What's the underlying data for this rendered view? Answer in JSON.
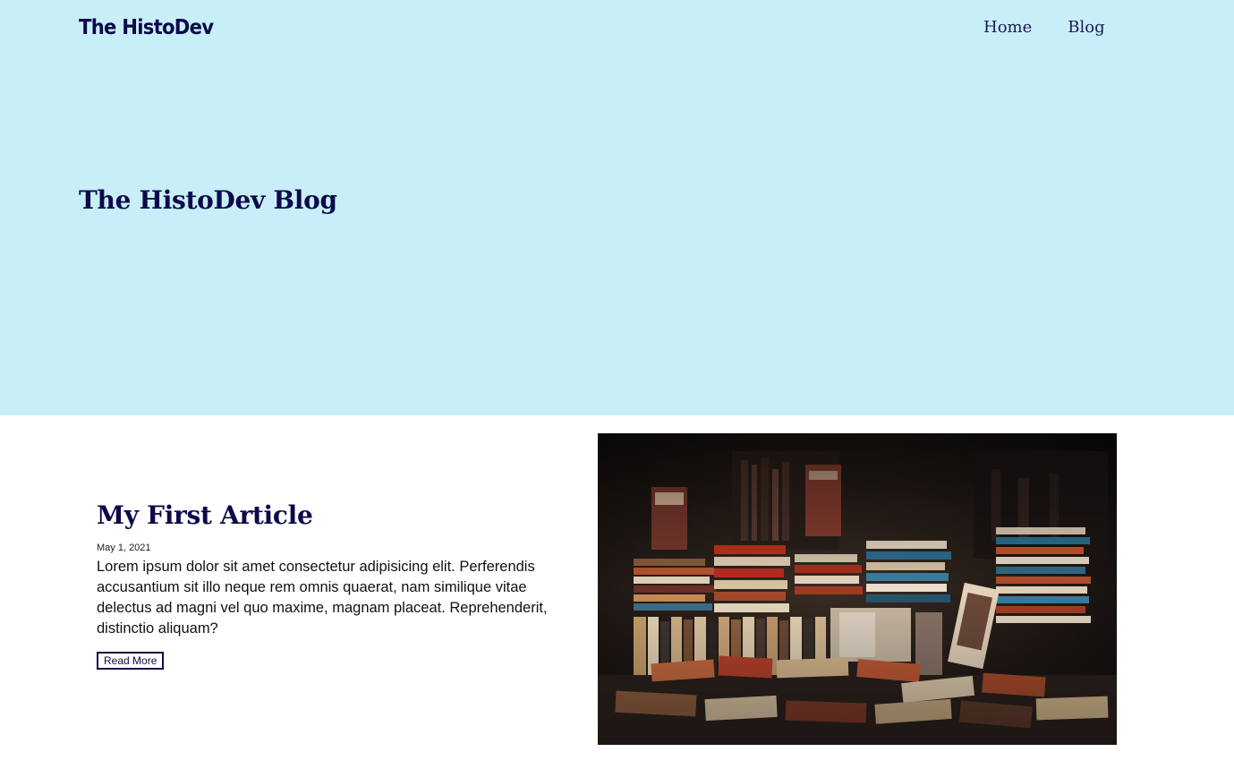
{
  "header": {
    "brand": "The HistoDev",
    "nav": [
      {
        "label": "Home"
      },
      {
        "label": "Blog"
      }
    ]
  },
  "hero": {
    "title": "The HistoDev Blog",
    "background": "#c8eff7"
  },
  "article": {
    "title": "My First Article",
    "date": "May 1, 2021",
    "excerpt": "Lorem ipsum dolor sit amet consectetur adipisicing elit. Perferendis accusantium sit illo neque rem omnis quaerat, nam similique vitae delectus ad magni vel quo maxime, magnam placeat. Reprehenderit, distinctio aliquam?",
    "read_more_label": "Read More",
    "image_description_icon": "bookstore-photo"
  },
  "colors": {
    "accent": "#0c0a4a",
    "hero_bg": "#c8eff7"
  }
}
